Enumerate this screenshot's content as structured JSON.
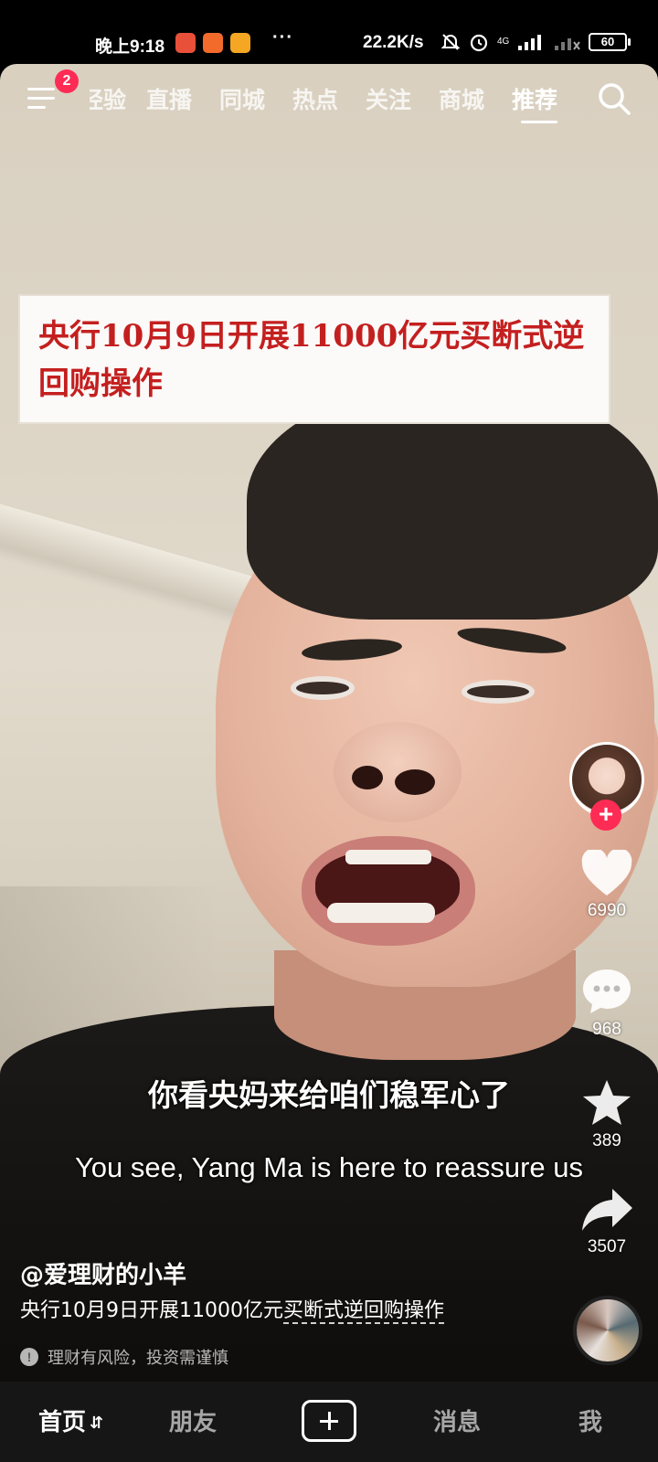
{
  "status_bar": {
    "time": "晚上9:18",
    "more": "···",
    "net_speed": "22.2K/s",
    "network": "4G",
    "battery": "60"
  },
  "top_nav": {
    "badge": "2",
    "tabs": [
      {
        "label": "经验",
        "active": false
      },
      {
        "label": "直播",
        "active": false
      },
      {
        "label": "同城",
        "active": false
      },
      {
        "label": "热点",
        "active": false
      },
      {
        "label": "关注",
        "active": false
      },
      {
        "label": "商城",
        "active": false
      },
      {
        "label": "推荐",
        "active": true
      }
    ]
  },
  "headline": "央行10月9日开展11000亿元买断式逆回购操作",
  "subtitles": {
    "cn": "你看央妈来给咱们稳军心了",
    "en": "You see, Yang Ma is here to reassure us"
  },
  "actions": {
    "likes": "6990",
    "comments": "968",
    "favorites": "389",
    "shares": "3507"
  },
  "post": {
    "author": "@爱理财的小羊",
    "caption_prefix": "央行10月9日开展11000亿元",
    "caption_link": "买断式逆回购操作",
    "risk_notice": "理财有风险，投资需谨慎"
  },
  "bottom_nav": {
    "home": "首页",
    "friends": "朋友",
    "messages": "消息",
    "me": "我"
  },
  "colors": {
    "accent": "#fe2c55",
    "headline_red": "#c41f1f"
  }
}
